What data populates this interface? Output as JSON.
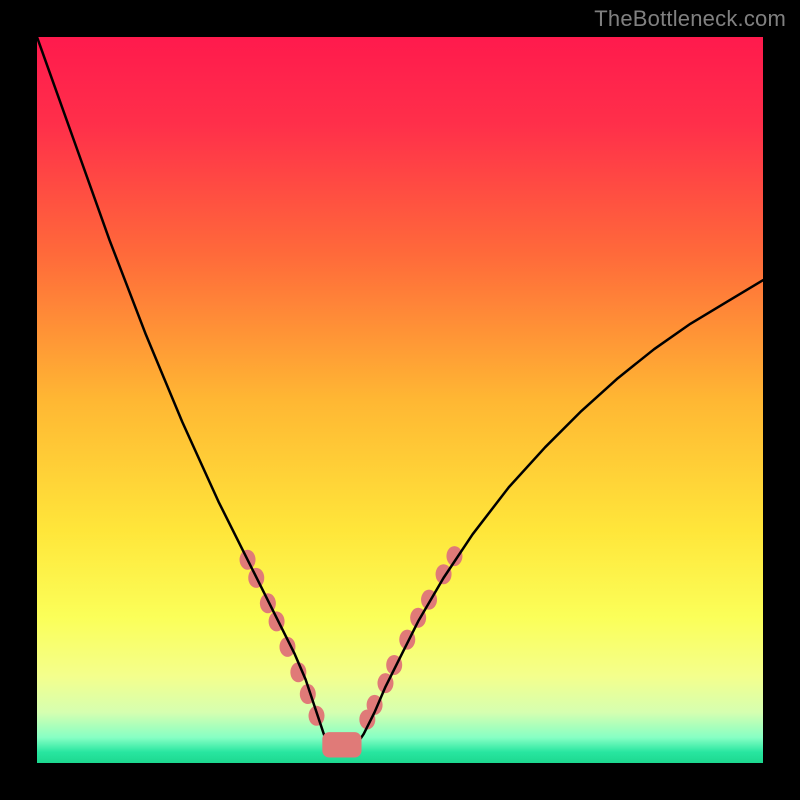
{
  "watermark": "TheBottleneck.com",
  "chart_data": {
    "type": "line",
    "title": "",
    "xlabel": "",
    "ylabel": "",
    "xlim": [
      0,
      100
    ],
    "ylim": [
      0,
      100
    ],
    "background_gradient": {
      "stops": [
        {
          "offset": 0.0,
          "color": "#ff1a4d"
        },
        {
          "offset": 0.12,
          "color": "#ff2f4a"
        },
        {
          "offset": 0.3,
          "color": "#ff6a3a"
        },
        {
          "offset": 0.5,
          "color": "#ffb733"
        },
        {
          "offset": 0.68,
          "color": "#ffe63a"
        },
        {
          "offset": 0.8,
          "color": "#fbff59"
        },
        {
          "offset": 0.88,
          "color": "#f4ff8c"
        },
        {
          "offset": 0.93,
          "color": "#d6ffb0"
        },
        {
          "offset": 0.965,
          "color": "#86ffc4"
        },
        {
          "offset": 0.985,
          "color": "#28e6a0"
        },
        {
          "offset": 1.0,
          "color": "#1dd88f"
        }
      ]
    },
    "series": [
      {
        "name": "bottleneck-curve",
        "stroke": "#000000",
        "stroke_width": 2.5,
        "x": [
          0.0,
          2.5,
          5.0,
          7.5,
          10.0,
          12.5,
          15.0,
          17.5,
          20.0,
          22.5,
          25.0,
          27.5,
          30.0,
          32.5,
          34.0,
          35.5,
          37.0,
          38.0,
          39.0,
          40.0,
          44.0,
          45.0,
          46.5,
          48.0,
          50.0,
          52.5,
          56.0,
          60.0,
          65.0,
          70.0,
          75.0,
          80.0,
          85.0,
          90.0,
          95.0,
          100.0
        ],
        "y": [
          100.0,
          93.0,
          86.0,
          79.0,
          72.0,
          65.5,
          59.0,
          53.0,
          47.0,
          41.5,
          36.0,
          31.0,
          26.0,
          21.0,
          18.0,
          15.0,
          11.5,
          8.5,
          5.5,
          2.5,
          2.5,
          4.0,
          7.0,
          10.5,
          14.5,
          19.5,
          25.5,
          31.5,
          38.0,
          43.5,
          48.5,
          53.0,
          57.0,
          60.5,
          63.5,
          66.5
        ]
      }
    ],
    "trough_flat": {
      "x_start": 40.0,
      "x_end": 44.0,
      "y": 2.5
    },
    "markers": {
      "fill": "#e07a78",
      "left": [
        {
          "x": 29.0,
          "y": 28.0
        },
        {
          "x": 30.2,
          "y": 25.5
        },
        {
          "x": 31.8,
          "y": 22.0
        },
        {
          "x": 33.0,
          "y": 19.5
        },
        {
          "x": 34.5,
          "y": 16.0
        },
        {
          "x": 36.0,
          "y": 12.5
        },
        {
          "x": 37.3,
          "y": 9.5
        },
        {
          "x": 38.5,
          "y": 6.5
        }
      ],
      "right": [
        {
          "x": 45.5,
          "y": 6.0
        },
        {
          "x": 46.5,
          "y": 8.0
        },
        {
          "x": 48.0,
          "y": 11.0
        },
        {
          "x": 49.2,
          "y": 13.5
        },
        {
          "x": 51.0,
          "y": 17.0
        },
        {
          "x": 52.5,
          "y": 20.0
        },
        {
          "x": 54.0,
          "y": 22.5
        },
        {
          "x": 56.0,
          "y": 26.0
        },
        {
          "x": 57.5,
          "y": 28.5
        }
      ],
      "trough_bar": {
        "x_start": 39.3,
        "x_end": 44.7,
        "y": 2.5,
        "height": 3.5
      }
    }
  }
}
